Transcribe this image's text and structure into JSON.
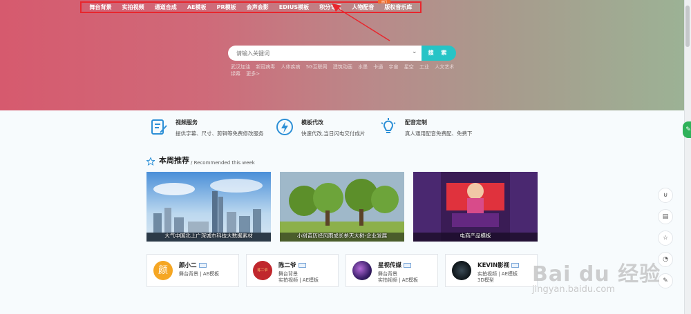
{
  "nav": {
    "items": [
      "舞台背景",
      "实拍视频",
      "通道合成",
      "AE模板",
      "PR模板",
      "会声会影",
      "EDIUS模板",
      "积分专区",
      "人物配音",
      "版权音乐库"
    ],
    "hot_badge": "热门"
  },
  "search": {
    "placeholder": "请输入关键词",
    "button": "搜 索",
    "hot_tags": [
      "武汉加油",
      "新冠病毒",
      "人体疾病",
      "5G互联网",
      "建筑动画",
      "水墨",
      "卡通",
      "宇宙",
      "星空",
      "工业",
      "人文艺术",
      "绿幕",
      "更多>"
    ]
  },
  "services": [
    {
      "title": "视频服务",
      "desc": "提供字幕、尺寸、剪辑等免费修改服务",
      "icon": "clipboard-edit-icon"
    },
    {
      "title": "模板代改",
      "desc": "快速代改,当日闪电交付成片",
      "icon": "lightning-icon"
    },
    {
      "title": "配音定制",
      "desc": "真人通用配音免费配、免费下",
      "icon": "lightbulb-icon"
    }
  ],
  "weekly": {
    "title": "本周推荐",
    "subtitle": "/ Recommended this week",
    "cards": [
      {
        "caption": "大气中国北上广深城市科技大数据素材"
      },
      {
        "caption": "小树苗历经风雨成长参天大树-企业发展"
      },
      {
        "caption": "电商产品模板"
      }
    ]
  },
  "authors": [
    {
      "name": "颜小二",
      "avatar_text": "颜",
      "tags": [
        "舞台背景 | AE模板"
      ]
    },
    {
      "name": "陈二爷",
      "avatar_text": "陈二爷",
      "tags": [
        "舞台背景",
        "实拍视频 | AE模板"
      ]
    },
    {
      "name": "星视传媒",
      "avatar_text": "",
      "tags": [
        "舞台背景",
        "实拍视频 | AE模板"
      ]
    },
    {
      "name": "KEVIN影视",
      "avatar_text": "",
      "tags": [
        "实拍视频 | AE模板",
        "3D模型"
      ]
    }
  ],
  "watermark": {
    "brand": "Bai du 经验",
    "url": "jingyan.baidu.com"
  },
  "colors": {
    "accent": "#26c4c6",
    "highlight": "#e8262d",
    "nav_bg_from": "#d65a6e",
    "nav_bg_to": "#9cb295"
  }
}
